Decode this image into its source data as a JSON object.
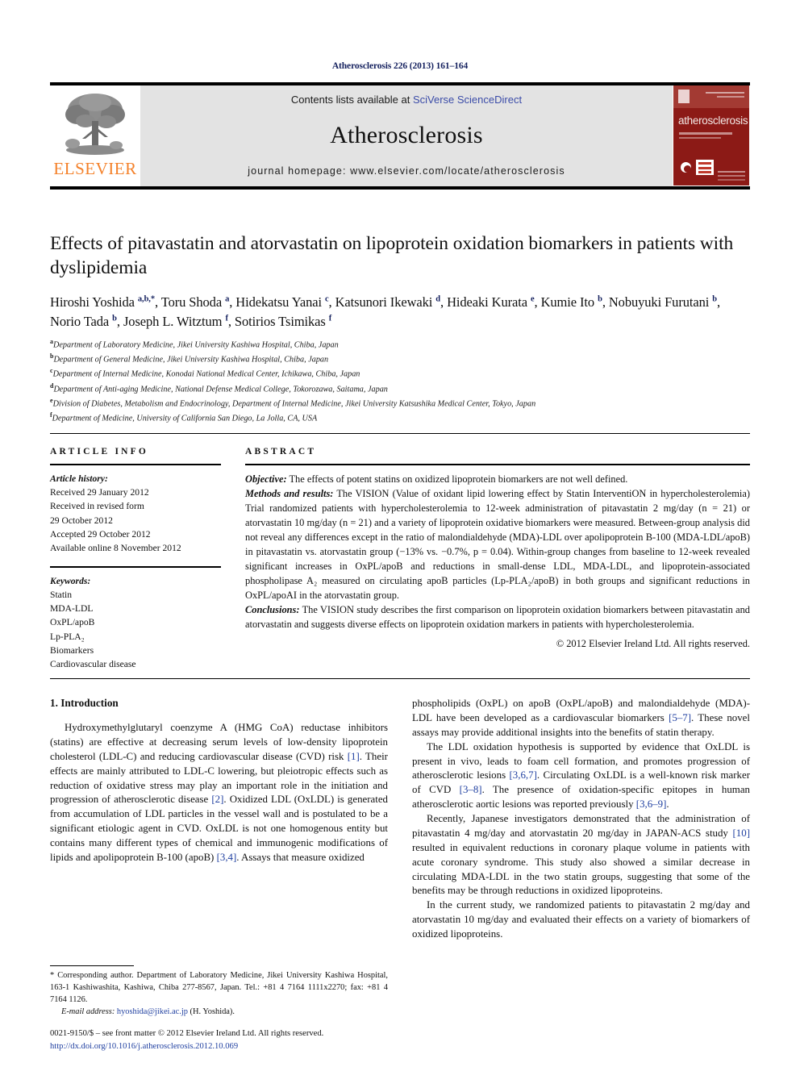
{
  "running_head": "Atherosclerosis 226 (2013) 161–164",
  "masthead": {
    "publisher_logo_label": "ELSEVIER",
    "contents_prefix": "Contents lists available at ",
    "contents_link": "SciVerse ScienceDirect",
    "journal_name": "Atherosclerosis",
    "homepage": "journal homepage: www.elsevier.com/locate/atherosclerosis",
    "cover_title": "atherosclerosis"
  },
  "article": {
    "title": "Effects of pitavastatin and atorvastatin on lipoprotein oxidation biomarkers in patients with dyslipidemia",
    "authors_html": "Hiroshi Yoshida <sup>a,b,</sup><sup>*</sup>, Toru Shoda <sup>a</sup>, Hidekatsu Yanai <sup>c</sup>, Katsunori Ikewaki <sup>d</sup>, Hideaki Kurata <sup>e</sup>, Kumie Ito <sup>b</sup>, Nobuyuki Furutani <sup>b</sup>, Norio Tada <sup>b</sup>, Joseph L. Witztum <sup>f</sup>, Sotirios Tsimikas <sup>f</sup>",
    "affiliations": [
      {
        "marker": "a",
        "text": "Department of Laboratory Medicine, Jikei University Kashiwa Hospital, Chiba, Japan"
      },
      {
        "marker": "b",
        "text": "Department of General Medicine, Jikei University Kashiwa Hospital, Chiba, Japan"
      },
      {
        "marker": "c",
        "text": "Department of Internal Medicine, Konodai National Medical Center, Ichikawa, Chiba, Japan"
      },
      {
        "marker": "d",
        "text": "Department of Anti-aging Medicine, National Defense Medical College, Tokorozawa, Saitama, Japan"
      },
      {
        "marker": "e",
        "text": "Division of Diabetes, Metabolism and Endocrinology, Department of Internal Medicine, Jikei University Katsushika Medical Center, Tokyo, Japan"
      },
      {
        "marker": "f",
        "text": "Department of Medicine, University of California San Diego, La Jolla, CA, USA"
      }
    ]
  },
  "article_info": {
    "heading": "ARTICLE INFO",
    "history_label": "Article history:",
    "history_lines": [
      "Received 29 January 2012",
      "Received in revised form",
      "29 October 2012",
      "Accepted 29 October 2012",
      "Available online 8 November 2012"
    ],
    "keywords_label": "Keywords:",
    "keywords": [
      "Statin",
      "MDA-LDL",
      "OxPL/apoB",
      "Lp-PLA₂",
      "Biomarkers",
      "Cardiovascular disease"
    ]
  },
  "abstract": {
    "heading": "ABSTRACT",
    "objective_label": "Objective:",
    "objective_text": " The effects of potent statins on oxidized lipoprotein biomarkers are not well defined.",
    "methods_label": "Methods and results:",
    "methods_text": " The VISION (Value of oxidant lipid lowering effect by Statin InterventiON in hypercholesterolemia) Trial randomized patients with hypercholesterolemia to 12-week administration of pitavastatin 2 mg/day (n = 21) or atorvastatin 10 mg/day (n = 21) and a variety of lipoprotein oxidative biomarkers were measured. Between-group analysis did not reveal any differences except in the ratio of malondialdehyde (MDA)-LDL over apolipoprotein B-100 (MDA-LDL/apoB) in pitavastatin vs. atorvastatin group (−13% vs. −0.7%, p = 0.04). Within-group changes from baseline to 12-week revealed significant increases in OxPL/apoB and reductions in small-dense LDL, MDA-LDL, and lipoprotein-associated phospholipase A₂ measured on circulating apoB particles (Lp-PLA₂/apoB) in both groups and significant reductions in OxPL/apoAI in the atorvastatin group.",
    "conclusions_label": "Conclusions:",
    "conclusions_text": " The VISION study describes the first comparison on lipoprotein oxidation biomarkers between pitavastatin and atorvastatin and suggests diverse effects on lipoprotein oxidation markers in patients with hypercholesterolemia.",
    "copyright": "© 2012 Elsevier Ireland Ltd. All rights reserved."
  },
  "introduction": {
    "heading": "1. Introduction",
    "left_paragraphs": [
      "Hydroxymethylglutaryl coenzyme A (HMG CoA) reductase inhibitors (statins) are effective at decreasing serum levels of low-density lipoprotein cholesterol (LDL-C) and reducing cardiovascular disease (CVD) risk [1]. Their effects are mainly attributed to LDL-C lowering, but pleiotropic effects such as reduction of oxidative stress may play an important role in the initiation and progression of atherosclerotic disease [2]. Oxidized LDL (OxLDL) is generated from accumulation of LDL particles in the vessel wall and is postulated to be a significant etiologic agent in CVD. OxLDL is not one homogenous entity but contains many different types of chemical and immunogenic modifications of lipids and apolipoprotein B-100 (apoB) [3,4]. Assays that measure oxidized"
    ],
    "right_paragraphs": [
      "phospholipids (OxPL) on apoB (OxPL/apoB) and malondialdehyde (MDA)-LDL have been developed as a cardiovascular biomarkers [5–7]. These novel assays may provide additional insights into the benefits of statin therapy.",
      "The LDL oxidation hypothesis is supported by evidence that OxLDL is present in vivo, leads to foam cell formation, and promotes progression of atherosclerotic lesions [3,6,7]. Circulating OxLDL is a well-known risk marker of CVD [3–8]. The presence of oxidation-specific epitopes in human atherosclerotic aortic lesions was reported previously [3,6–9].",
      "Recently, Japanese investigators demonstrated that the administration of pitavastatin 4 mg/day and atorvastatin 20 mg/day in JAPAN-ACS study [10] resulted in equivalent reductions in coronary plaque volume in patients with acute coronary syndrome. This study also showed a similar decrease in circulating MDA-LDL in the two statin groups, suggesting that some of the benefits may be through reductions in oxidized lipoproteins.",
      "In the current study, we randomized patients to pitavastatin 2 mg/day and atorvastatin 10 mg/day and evaluated their effects on a variety of biomarkers of oxidized lipoproteins."
    ]
  },
  "footnotes": {
    "corresponding": "* Corresponding author. Department of Laboratory Medicine, Jikei University Kashiwa Hospital, 163-1 Kashiwashita, Kashiwa, Chiba 277-8567, Japan. Tel.: +81 4 7164 1111x2270; fax: +81 4 7164 1126.",
    "email_label": "E-mail address:",
    "email": "hyoshida@jikei.ac.jp",
    "email_suffix": " (H. Yoshida).",
    "issn_line": "0021-9150/$ – see front matter © 2012 Elsevier Ireland Ltd. All rights reserved.",
    "doi_line": "http://dx.doi.org/10.1016/j.atherosclerosis.2012.10.069"
  },
  "colors": {
    "link": "#1f3fa0",
    "running_head": "#14205e",
    "elsevier_orange": "#f4812a",
    "cover_red": "#8c1a16",
    "masthead_gray": "#e3e3e3"
  }
}
